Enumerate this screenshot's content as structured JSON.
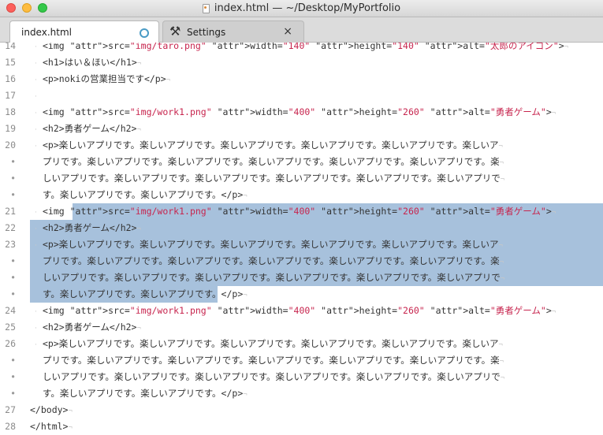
{
  "window": {
    "title": "index.html — ~/Desktop/MyPortfolio"
  },
  "tabs": [
    {
      "label": "index.html",
      "active": true,
      "dirty": true
    },
    {
      "label": "Settings",
      "active": false,
      "icon": "tools-icon",
      "close": "×"
    }
  ],
  "editor": {
    "lines": [
      {
        "num": "14",
        "text": "<img src=\"img/taro.png\" width=\"140\" height=\"140\" alt=\"太郎のアイコン\">",
        "indent": true
      },
      {
        "num": "15",
        "text": "<h1>はい＆ほい</h1>",
        "indent": true
      },
      {
        "num": "16",
        "text": "<p>nokiの営業担当です</p>",
        "indent": true
      },
      {
        "num": "17",
        "text": "",
        "indent": true
      },
      {
        "num": "18",
        "text": "<img src=\"img/work1.png\" width=\"400\" height=\"260\" alt=\"勇者ゲーム\">",
        "indent": true
      },
      {
        "num": "19",
        "text": "<h2>勇者ゲーム</h2>",
        "indent": true
      },
      {
        "num": "20",
        "text": "<p>楽しいアプリです。楽しいアプリです。楽しいアプリです。楽しいアプリです。楽しいアプリです。楽しいア",
        "indent": true
      },
      {
        "num": "•",
        "text": "プリです。楽しいアプリです。楽しいアプリです。楽しいアプリです。楽しいアプリです。楽しいアプリです。楽",
        "indent": false
      },
      {
        "num": "•",
        "text": "しいアプリです。楽しいアプリです。楽しいアプリです。楽しいアプリです。楽しいアプリです。楽しいアプリで",
        "indent": false
      },
      {
        "num": "•",
        "text": "す。楽しいアプリです。楽しいアプリです。</p>",
        "indent": false
      },
      {
        "num": "21",
        "text": "<img src=\"img/work1.png\" width=\"400\" height=\"260\" alt=\"勇者ゲーム\">",
        "indent": true
      },
      {
        "num": "22",
        "text": "<h2>勇者ゲーム</h2>",
        "indent": true
      },
      {
        "num": "23",
        "text": "<p>楽しいアプリです。楽しいアプリです。楽しいアプリです。楽しいアプリです。楽しいアプリです。楽しいア",
        "indent": true
      },
      {
        "num": "•",
        "text": "プリです。楽しいアプリです。楽しいアプリです。楽しいアプリです。楽しいアプリです。楽しいアプリです。楽",
        "indent": false
      },
      {
        "num": "•",
        "text": "しいアプリです。楽しいアプリです。楽しいアプリです。楽しいアプリです。楽しいアプリです。楽しいアプリで",
        "indent": false
      },
      {
        "num": "•",
        "text": "す。楽しいアプリです。楽しいアプリです。</p>",
        "indent": false
      },
      {
        "num": "24",
        "text": "<img src=\"img/work1.png\" width=\"400\" height=\"260\" alt=\"勇者ゲーム\">",
        "indent": true
      },
      {
        "num": "25",
        "text": "<h2>勇者ゲーム</h2>",
        "indent": true
      },
      {
        "num": "26",
        "text": "<p>楽しいアプリです。楽しいアプリです。楽しいアプリです。楽しいアプリです。楽しいアプリです。楽しいア",
        "indent": true
      },
      {
        "num": "•",
        "text": "プリです。楽しいアプリです。楽しいアプリです。楽しいアプリです。楽しいアプリです。楽しいアプリです。楽",
        "indent": false
      },
      {
        "num": "•",
        "text": "しいアプリです。楽しいアプリです。楽しいアプリです。楽しいアプリです。楽しいアプリです。楽しいアプリで",
        "indent": false
      },
      {
        "num": "•",
        "text": "す。楽しいアプリです。楽しいアプリです。</p>",
        "indent": false
      },
      {
        "num": "27",
        "text": "</body>",
        "indent": false
      },
      {
        "num": "28",
        "text": "</html>",
        "indent": false
      }
    ]
  },
  "colors": {
    "selection": "#a7c1dc",
    "tag": "#333333",
    "attr": "#3b5d82",
    "string": "#c7254e",
    "gutter": "#8c8c8c"
  }
}
